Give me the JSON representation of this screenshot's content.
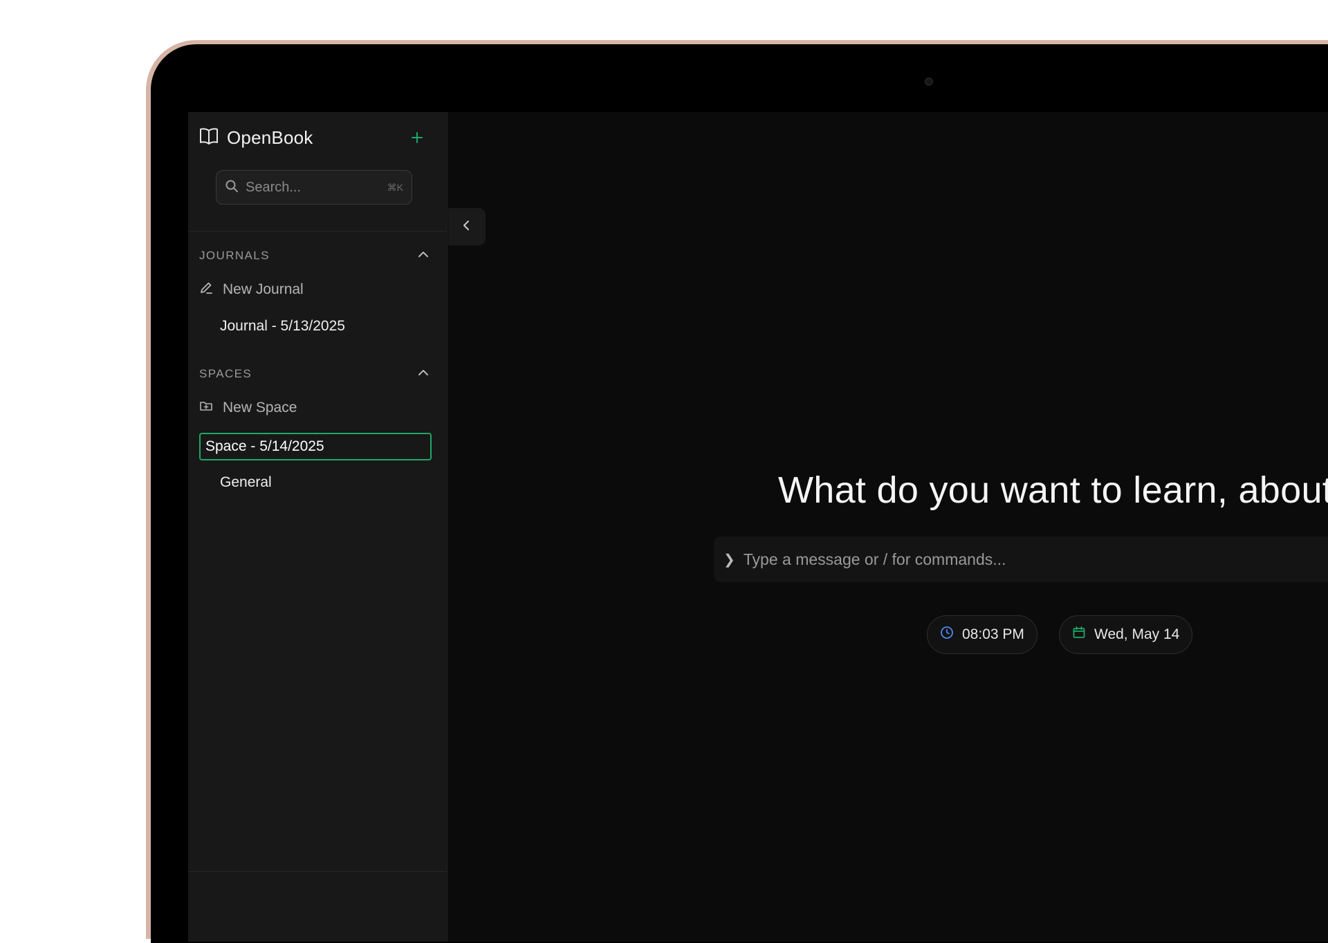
{
  "app": {
    "name": "OpenBook",
    "accent_color": "#1fa868"
  },
  "search": {
    "placeholder": "Search...",
    "shortcut": "⌘K"
  },
  "journals": {
    "title": "JOURNALS",
    "new_label": "New Journal",
    "items": [
      "Journal - 5/13/2025"
    ]
  },
  "spaces": {
    "title": "SPACES",
    "new_label": "New Space",
    "items": [
      "Space - 5/14/2025",
      "General"
    ],
    "selected": "Space - 5/14/2025"
  },
  "main": {
    "headline": "What do you want to learn, about",
    "composer_placeholder": "Type a message or / for commands...",
    "time": "08:03 PM",
    "date": "Wed, May 14"
  },
  "icons": {
    "brand": "book-open-icon",
    "add": "plus-icon",
    "search": "search-icon",
    "collapse": "chevron-left-icon",
    "section_toggle": "chevron-up-icon",
    "new_journal": "pencil-icon",
    "new_space": "folder-plus-icon",
    "time": "clock-icon",
    "date": "calendar-icon"
  }
}
